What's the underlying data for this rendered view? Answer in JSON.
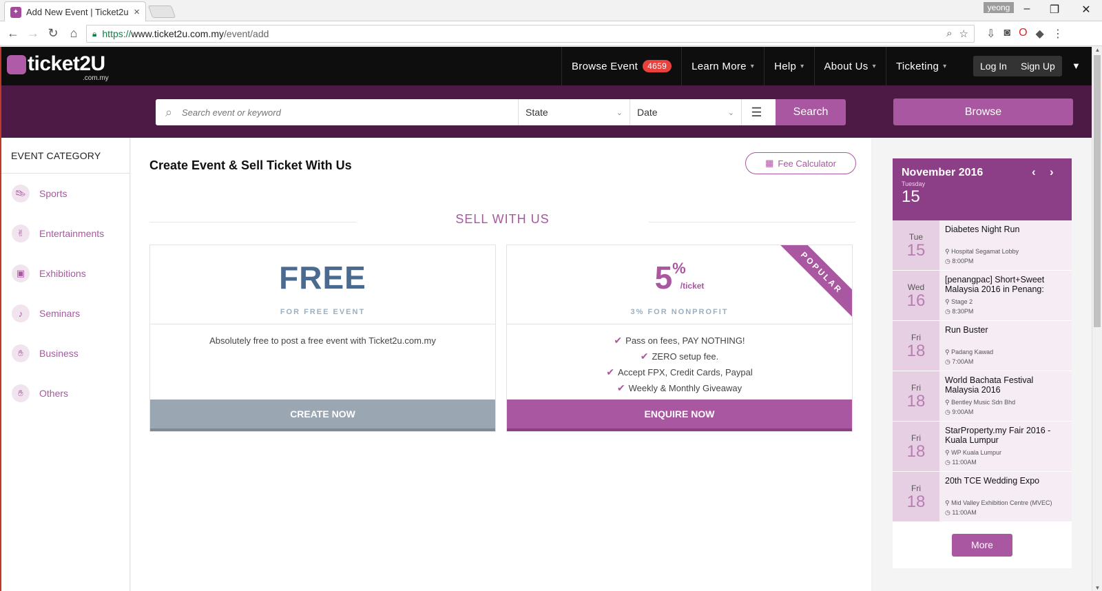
{
  "browser": {
    "tab_title": "Add New Event | Ticket2u",
    "tab_close": "×",
    "profile": "yeong",
    "url_scheme": "https://",
    "url_host": "www.ticket2u.com.my",
    "url_path": "/event/add"
  },
  "header": {
    "logo_text": "ticket2U",
    "logo_sub": ".com.my",
    "nav": [
      {
        "label": "Browse Event",
        "badge": "4659"
      },
      {
        "label": "Learn More"
      },
      {
        "label": "Help"
      },
      {
        "label": "About Us"
      },
      {
        "label": "Ticketing"
      }
    ],
    "login": "Log In",
    "signup": "Sign Up"
  },
  "search": {
    "placeholder": "Search event or keyword",
    "state": "State",
    "date": "Date",
    "button": "Search",
    "browse": "Browse"
  },
  "sidebar": {
    "title": "EVENT CATEGORY",
    "items": [
      {
        "label": "Sports",
        "icon": "shoe-icon"
      },
      {
        "label": "Entertainments",
        "icon": "rock-hand-icon"
      },
      {
        "label": "Exhibitions",
        "icon": "exhibition-icon"
      },
      {
        "label": "Seminars",
        "icon": "microphone-icon"
      },
      {
        "label": "Business",
        "icon": "handshake-icon"
      },
      {
        "label": "Others",
        "icon": "hand-icon"
      }
    ]
  },
  "main": {
    "title": "Create Event & Sell Ticket With Us",
    "fee_calculator": "Fee Calculator",
    "sell_title": "SELL WITH US",
    "plans": [
      {
        "big": "FREE",
        "sub": "FOR FREE EVENT",
        "features": [
          "Absolutely free to post a free event with Ticket2u.com.my"
        ],
        "cta": "CREATE NOW"
      },
      {
        "big": "5",
        "big_symbol": "%",
        "unit": "/ticket",
        "sub": "3% FOR NONPROFIT",
        "ribbon": "POPULAR",
        "features": [
          "Pass on fees, PAY NOTHING!",
          "ZERO setup fee.",
          "Accept FPX, Credit Cards, Paypal",
          "Weekly & Monthly Giveaway"
        ],
        "cta": "ENQUIRE NOW"
      }
    ]
  },
  "calendar": {
    "month": "November 2016",
    "weekday": "Tuesday",
    "day": "15",
    "events": [
      {
        "dow": "Tue",
        "day": "15",
        "name": "Diabetes Night Run",
        "venue": "Hospital Segamat Lobby",
        "time": "8:00PM"
      },
      {
        "dow": "Wed",
        "day": "16",
        "name": "[penangpac] Short+Sweet Malaysia 2016 in Penang:",
        "venue": "Stage 2",
        "time": "8:30PM"
      },
      {
        "dow": "Fri",
        "day": "18",
        "name": "Run Buster",
        "venue": "Padang Kawad",
        "time": "7:00AM"
      },
      {
        "dow": "Fri",
        "day": "18",
        "name": "World Bachata Festival Malaysia 2016",
        "venue": "Bentley Music Sdn Bhd",
        "time": "9:00AM"
      },
      {
        "dow": "Fri",
        "day": "18",
        "name": "StarProperty.my Fair 2016 - Kuala Lumpur",
        "venue": "WP Kuala Lumpur",
        "time": "11:00AM"
      },
      {
        "dow": "Fri",
        "day": "18",
        "name": "20th TCE Wedding Expo",
        "venue": "Mid Valley Exhibition Centre (MVEC)",
        "time": "11:00AM"
      }
    ],
    "more": "More"
  },
  "colors": {
    "brand": "#a857a0",
    "header_bg": "#0e0e0e",
    "search_band": "#4d1a45"
  }
}
